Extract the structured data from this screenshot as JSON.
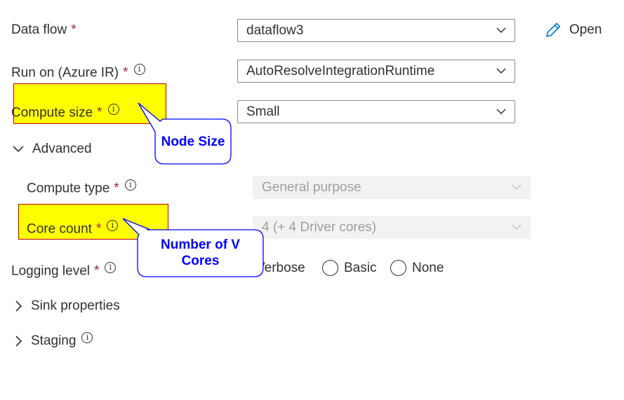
{
  "form": {
    "data_flow": {
      "label": "Data flow",
      "value": "dataflow3",
      "open_label": "Open"
    },
    "run_on": {
      "label": "Run on (Azure IR)",
      "value": "AutoResolveIntegrationRuntime"
    },
    "compute_size": {
      "label": "Compute size",
      "value": "Small"
    },
    "advanced": {
      "label": "Advanced",
      "compute_type": {
        "label": "Compute type",
        "value": "General purpose"
      },
      "core_count": {
        "label": "Core count",
        "value": "4 (+ 4 Driver cores)"
      }
    },
    "logging_level": {
      "label": "Logging level",
      "options": [
        "Verbose",
        "Basic",
        "None"
      ]
    },
    "sink_properties": {
      "label": "Sink properties"
    },
    "staging": {
      "label": "Staging"
    },
    "required_mark": "*",
    "info_glyph": "i"
  },
  "annotations": {
    "node_size": "Node Size",
    "vcores_line1": "Number of V",
    "vcores_line2": "Cores"
  },
  "colors": {
    "highlight": "#ffff00",
    "highlight_border": "#c00000",
    "callout_text": "#0000ff",
    "required": "#a4262c"
  }
}
